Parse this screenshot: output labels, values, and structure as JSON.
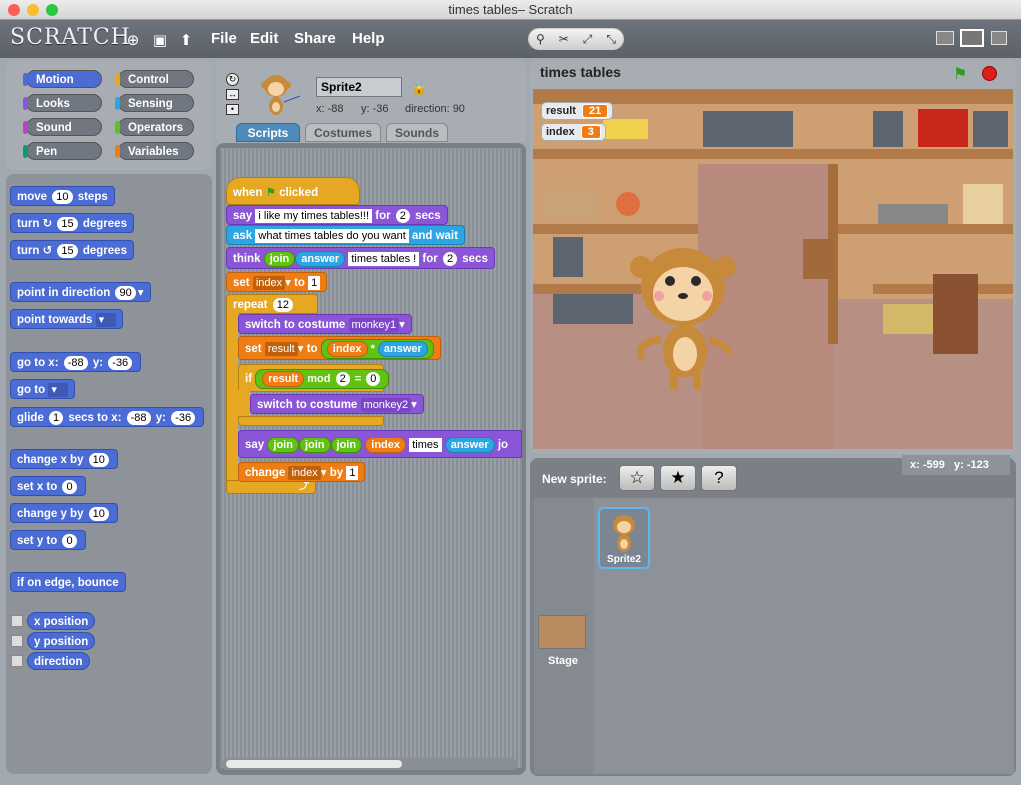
{
  "window": {
    "title": "times tables– Scratch"
  },
  "menubar": {
    "logo": "SCRATCH",
    "file": "File",
    "edit": "Edit",
    "share": "Share",
    "help": "Help"
  },
  "categories": [
    {
      "label": "Motion",
      "color": "#4a6cd4"
    },
    {
      "label": "Control",
      "color": "#e6a822"
    },
    {
      "label": "Looks",
      "color": "#8a55d7"
    },
    {
      "label": "Sensing",
      "color": "#2ca5e2"
    },
    {
      "label": "Sound",
      "color": "#bb42c3"
    },
    {
      "label": "Operators",
      "color": "#62c213"
    },
    {
      "label": "Pen",
      "color": "#0e9a6c"
    },
    {
      "label": "Variables",
      "color": "#ee7d16"
    }
  ],
  "palette": {
    "move": "move",
    "move_val": "10",
    "move_steps": "steps",
    "turn": "turn",
    "turn_val": "15",
    "degrees": "degrees",
    "point_dir": "point in direction",
    "point_dir_val": "90",
    "point_towards": "point towards",
    "goto_xy": "go to x:",
    "goto_x": "-88",
    "y_label": "y:",
    "goto_y": "-36",
    "goto": "go to",
    "glide": "glide",
    "glide_val": "1",
    "glide_secs": "secs to x:",
    "glide_x": "-88",
    "glide_y": "-36",
    "change_x": "change x by",
    "change_x_val": "10",
    "set_x": "set x to",
    "set_x_val": "0",
    "change_y": "change y by",
    "change_y_val": "10",
    "set_y": "set y to",
    "set_y_val": "0",
    "bounce": "if on edge, bounce",
    "xpos": "x position",
    "ypos": "y position",
    "direction": "direction"
  },
  "sprite": {
    "name": "Sprite2",
    "x": "x: -88",
    "y": "y: -36",
    "dir": "direction: 90"
  },
  "tabs": {
    "scripts": "Scripts",
    "costumes": "Costumes",
    "sounds": "Sounds"
  },
  "script": {
    "when": "when",
    "clicked": "clicked",
    "say": "say",
    "say_text": "i like my times tables!!!",
    "for": "for",
    "say_secs": "2",
    "secs": "secs",
    "ask": "ask",
    "ask_text": "what times tables do you want",
    "and_wait": "and wait",
    "think": "think",
    "join": "join",
    "answer": "answer",
    "think_text": "times tables !",
    "think_secs": "2",
    "set": "set",
    "index": "index",
    "to": "to",
    "set_val": "1",
    "repeat": "repeat",
    "repeat_val": "12",
    "switch": "switch to costume",
    "costume1": "monkey1",
    "result": "result",
    "times_op": "*",
    "if": "if",
    "mod": "mod",
    "mod_val": "2",
    "eq": "=",
    "eq_val": "0",
    "costume2": "monkey2",
    "times_text": "times",
    "jo": "jo",
    "change": "change",
    "by": "by",
    "change_val": "1"
  },
  "stage": {
    "title": "times tables",
    "watchers": [
      {
        "label": "result",
        "value": "21"
      },
      {
        "label": "index",
        "value": "3"
      }
    ],
    "mouse_x": "x: -599",
    "mouse_y": "y: -123"
  },
  "sprites_pane": {
    "new_sprite": "New sprite:",
    "sprite_name": "Sprite2",
    "stage_label": "Stage"
  }
}
